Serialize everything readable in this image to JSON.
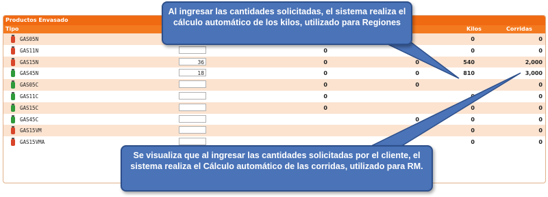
{
  "panel": {
    "title": "Productos Envasado",
    "headers": {
      "tipo": "Tipo",
      "kilos": "Kilos",
      "corridas": "Corridas"
    }
  },
  "rows": [
    {
      "name": "GAS05N",
      "qty": "",
      "c1": "",
      "c2": "",
      "kilos": "0",
      "corridas": "0",
      "color": "#d8452a"
    },
    {
      "name": "GAS11N",
      "qty": "",
      "c1": "0",
      "c2": "0",
      "kilos": "0",
      "corridas": "0",
      "color": "#d8452a"
    },
    {
      "name": "GAS15N",
      "qty": "36",
      "c1": "0",
      "c2": "0",
      "kilos": "540",
      "corridas": "2,000",
      "color": "#d8452a"
    },
    {
      "name": "GAS45N",
      "qty": "18",
      "c1": "0",
      "c2": "0",
      "kilos": "810",
      "corridas": "3,000",
      "color": "#2f9a3a"
    },
    {
      "name": "GAS05C",
      "qty": "",
      "c1": "0",
      "c2": "0",
      "kilos": "",
      "corridas": "0",
      "color": "#2f9a3a"
    },
    {
      "name": "GAS11C",
      "qty": "",
      "c1": "0",
      "c2": "",
      "kilos": "0",
      "corridas": "0",
      "color": "#2f9a3a"
    },
    {
      "name": "GAS15C",
      "qty": "",
      "c1": "0",
      "c2": "",
      "kilos": "0",
      "corridas": "0",
      "color": "#2f9a3a"
    },
    {
      "name": "GAS45C",
      "qty": "",
      "c1": "",
      "c2": "0",
      "kilos": "0",
      "corridas": "0",
      "color": "#2f9a3a"
    },
    {
      "name": "GAS15VM",
      "qty": "",
      "c1": "",
      "c2": "",
      "kilos": "0",
      "corridas": "0",
      "color": "#d8452a"
    },
    {
      "name": "GAS15VMA",
      "qty": "",
      "c1": "",
      "c2": "",
      "kilos": "0",
      "corridas": "0",
      "color": "#d8452a"
    }
  ],
  "callouts": {
    "top": "Al ingresar las cantidades solicitadas, el sistema realiza el cálculo automático de  los kilos, utilizado para Regiones",
    "bottom": "Se visualiza que al ingresar las cantidades solicitadas por el cliente, el sistema realiza el Cálculo automático de las corridas, utilizado para RM."
  }
}
